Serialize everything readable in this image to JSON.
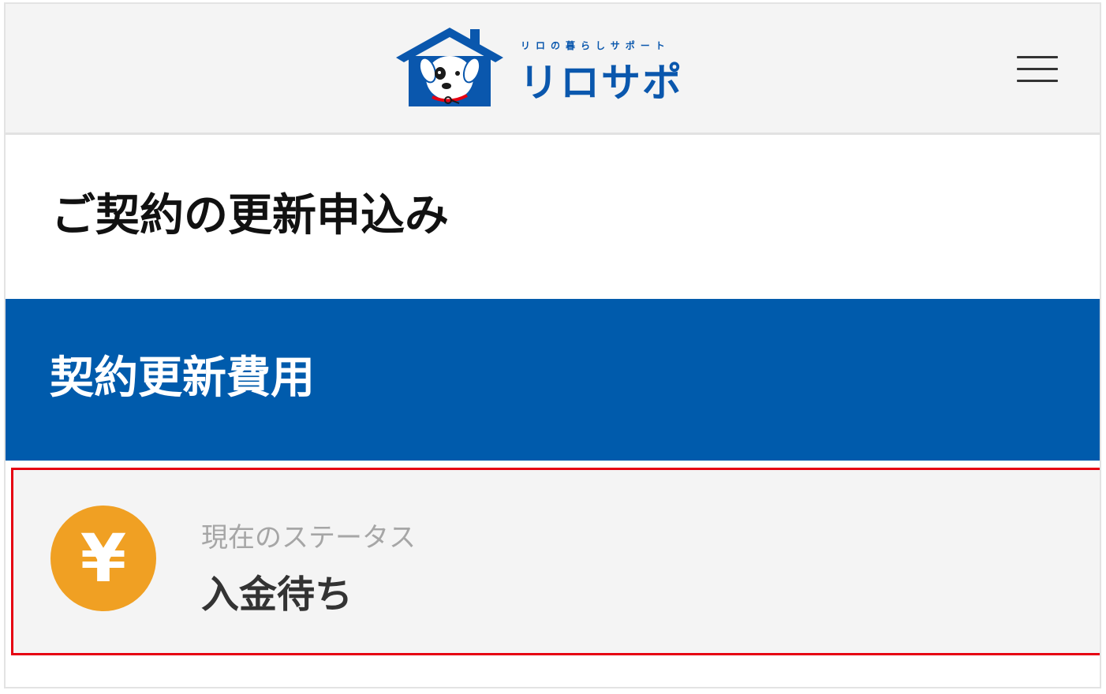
{
  "header": {
    "logo": {
      "tagline": "リロの暮らしサポート",
      "name": "リロサポ",
      "brand_color": "#0a57ad"
    },
    "menu_icon": "hamburger-menu-icon"
  },
  "page": {
    "title": "ご契約の更新申込み"
  },
  "section": {
    "title": "契約更新費用",
    "background_color": "#005bac"
  },
  "status": {
    "icon_glyph": "¥",
    "icon_name": "yen-icon",
    "icon_color": "#f0a023",
    "label": "現在のステータス",
    "value": "入金待ち",
    "highlight_color": "#e60012"
  }
}
